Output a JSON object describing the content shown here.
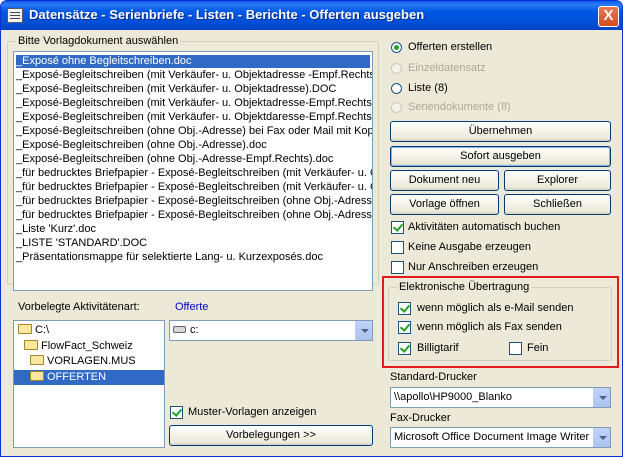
{
  "window": {
    "title": "Datensätze - Serienbriefe - Listen - Berichte - Offerten ausgeben",
    "close_label": "X"
  },
  "template_group": {
    "label": "Bitte Vorlagdokument auswählen",
    "items": [
      "_Exposé ohne Begleitschreiben.doc",
      "_Exposé-Begleitschreiben (mit Verkäufer- u. Objektadresse -Empf.Rechts).d",
      "_Exposé-Begleitschreiben (mit Verkäufer- u. Objektadresse).DOC",
      "_Exposé-Begleitschreiben (mit Verkäufer- u. Objektadresse-Empf.Rechts).d",
      "_Exposé-Begleitschreiben (mit Verkäufer- u. Objektdaresse-Empf.Rechts).d",
      "_Exposé-Begleitschreiben (ohne Obj.-Adresse) bei Fax oder Mail mit Kopf.d",
      "_Exposé-Begleitschreiben (ohne Obj.-Adresse).doc",
      "_Exposé-Begleitschreiben (ohne Obj.-Adresse-Empf.Rechts).doc",
      "_für bedrucktes Briefpapier - Exposé-Begleitschreiben (mit Verkäufer- u. Ob",
      "_für bedrucktes Briefpapier - Exposé-Begleitschreiben (mit Verkäufer- u. Ob",
      "_für bedrucktes Briefpapier - Exposé-Begleitschreiben (ohne Obj.-Adresse).",
      "_für bedrucktes Briefpapier - Exposé-Begleitschreiben (ohne Obj.-Adresse-E",
      "_Liste 'Kurz'.doc",
      "_LISTE 'STANDARD'.DOC",
      "_Präsentationsmappe für selektierte Lang- u. Kurzexposés.doc"
    ],
    "selected_index": 0
  },
  "activity": {
    "label": "Vorbelegte Aktivitätenart:",
    "value": "Offerte"
  },
  "folders": [
    "C:\\",
    "FlowFact_Schweiz",
    "VORLAGEN.MUS",
    "OFFERTEN"
  ],
  "drive": {
    "value": "c:"
  },
  "muster_checkbox": {
    "label": "Muster-Vorlagen anzeigen",
    "checked": true
  },
  "vorbelegungen_button": "Vorbelegungen >>",
  "output_options": [
    {
      "label": "Offerten erstellen",
      "checked": true,
      "enabled": true
    },
    {
      "label": "Einzeldatensatz",
      "checked": false,
      "enabled": false
    },
    {
      "label": "Liste (8)",
      "checked": false,
      "enabled": true
    },
    {
      "label": "Seriendokumente (8)",
      "checked": false,
      "enabled": false
    }
  ],
  "buttons": {
    "uebernehmen": "Übernehmen",
    "sofort": "Sofort ausgeben",
    "dokument_neu": "Dokument neu",
    "explorer": "Explorer",
    "vorlage_oeffnen": "Vorlage öffnen",
    "schliessen": "Schließen"
  },
  "options": [
    {
      "label": "Aktivitäten automatisch buchen",
      "checked": true
    },
    {
      "label": "Keine Ausgabe erzeugen",
      "checked": false
    },
    {
      "label": "Nur Anschreiben erzeugen",
      "checked": false
    }
  ],
  "electronic": {
    "label": "Elektronische Übertragung",
    "mail": {
      "label": "wenn möglich als e-Mail senden",
      "checked": true
    },
    "fax": {
      "label": "wenn möglich als Fax senden",
      "checked": true
    },
    "billig": {
      "label": "Billigtarif",
      "checked": true
    },
    "fein": {
      "label": "Fein",
      "checked": false
    }
  },
  "printer": {
    "label": "Standard-Drucker",
    "value": "\\\\apollo\\HP9000_Blanko"
  },
  "fax_printer": {
    "label": "Fax-Drucker",
    "value": "Microsoft Office Document Image Writer"
  },
  "colors": {
    "highlight": "#e11b1b",
    "selection": "#316ac5",
    "title": "#0058e6"
  }
}
